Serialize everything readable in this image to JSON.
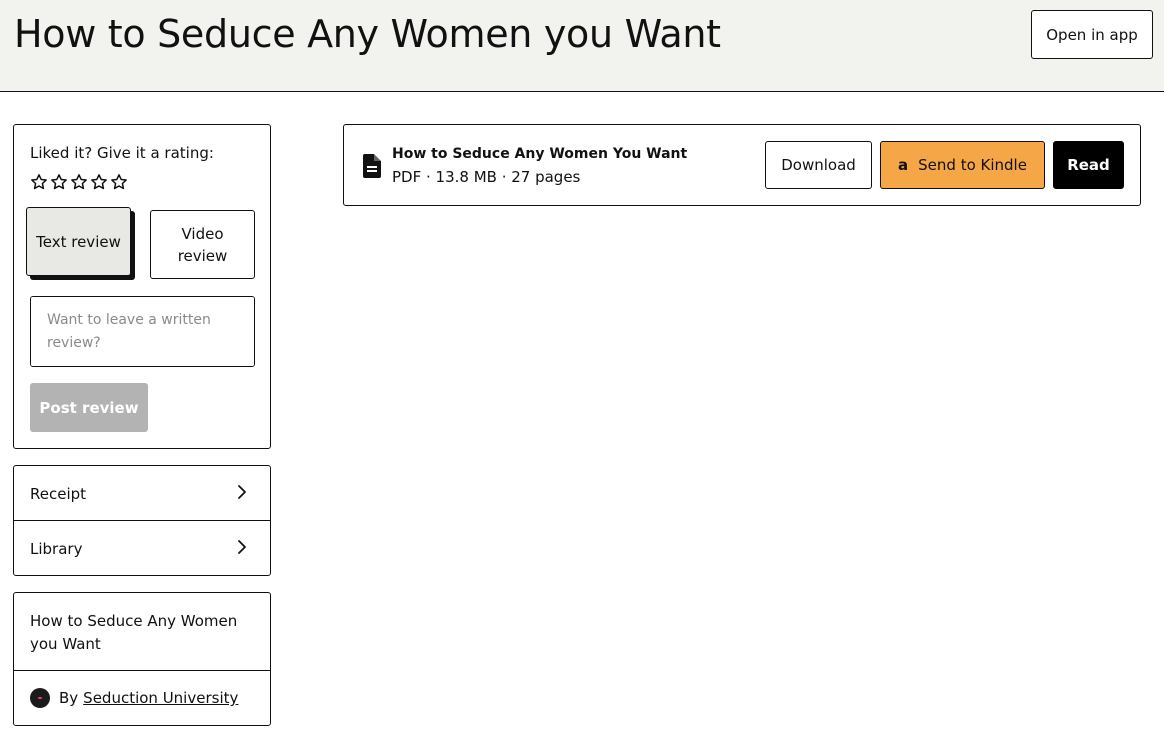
{
  "header": {
    "title": "How to Seduce Any Women you Want",
    "open_in_app_label": "Open in app"
  },
  "rating": {
    "prompt": "Liked it? Give it a rating:",
    "stars_total": 5,
    "stars_filled": 0,
    "text_review_label": "Text review",
    "video_review_label": "Video review",
    "review_placeholder": "Want to leave a written review?",
    "post_review_label": "Post review"
  },
  "links": {
    "receipt_label": "Receipt",
    "library_label": "Library"
  },
  "document": {
    "title": "How to Seduce Any Women you Want",
    "by_label": "By",
    "author": "Seduction University"
  },
  "file": {
    "name": "How to Seduce Any Women You Want",
    "meta": "PDF · 13.8 MB · 27 pages",
    "download_label": "Download",
    "kindle_icon_text": "a",
    "kindle_label": "Send to Kindle",
    "read_label": "Read"
  },
  "colors": {
    "header_bg": "#f2f2ee",
    "kindle_orange": "#f5a646",
    "disabled_gray": "#b3b3b3",
    "read_black": "#000000"
  },
  "icons": {
    "star": "star-outline-icon",
    "chevron": "chevron-right-icon",
    "file": "document-icon",
    "amazon": "amazon-icon"
  }
}
